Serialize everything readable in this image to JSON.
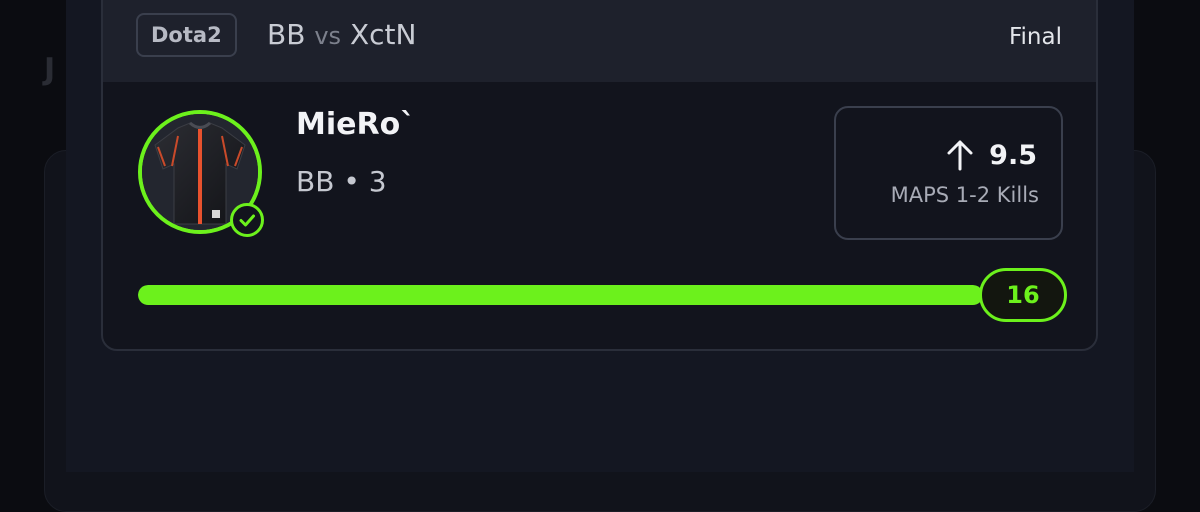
{
  "card": {
    "game_tag": "Dota2",
    "team_home": "BB",
    "vs_label": "vs",
    "team_away": "XctN",
    "status": "Final"
  },
  "player": {
    "name": "MieRo`",
    "team_line": "BB • 3",
    "avatar_icon": "jersey-icon",
    "verified_icon": "check-circle-icon"
  },
  "projection": {
    "direction_icon": "arrow-up-icon",
    "line": "9.5",
    "label": "MAPS 1-2 Kills"
  },
  "result": {
    "value": "16",
    "progress_fraction": 1.0
  },
  "colors": {
    "accent": "#6cf11c",
    "card_bg": "#12141d",
    "header_bg": "#1e212c"
  }
}
